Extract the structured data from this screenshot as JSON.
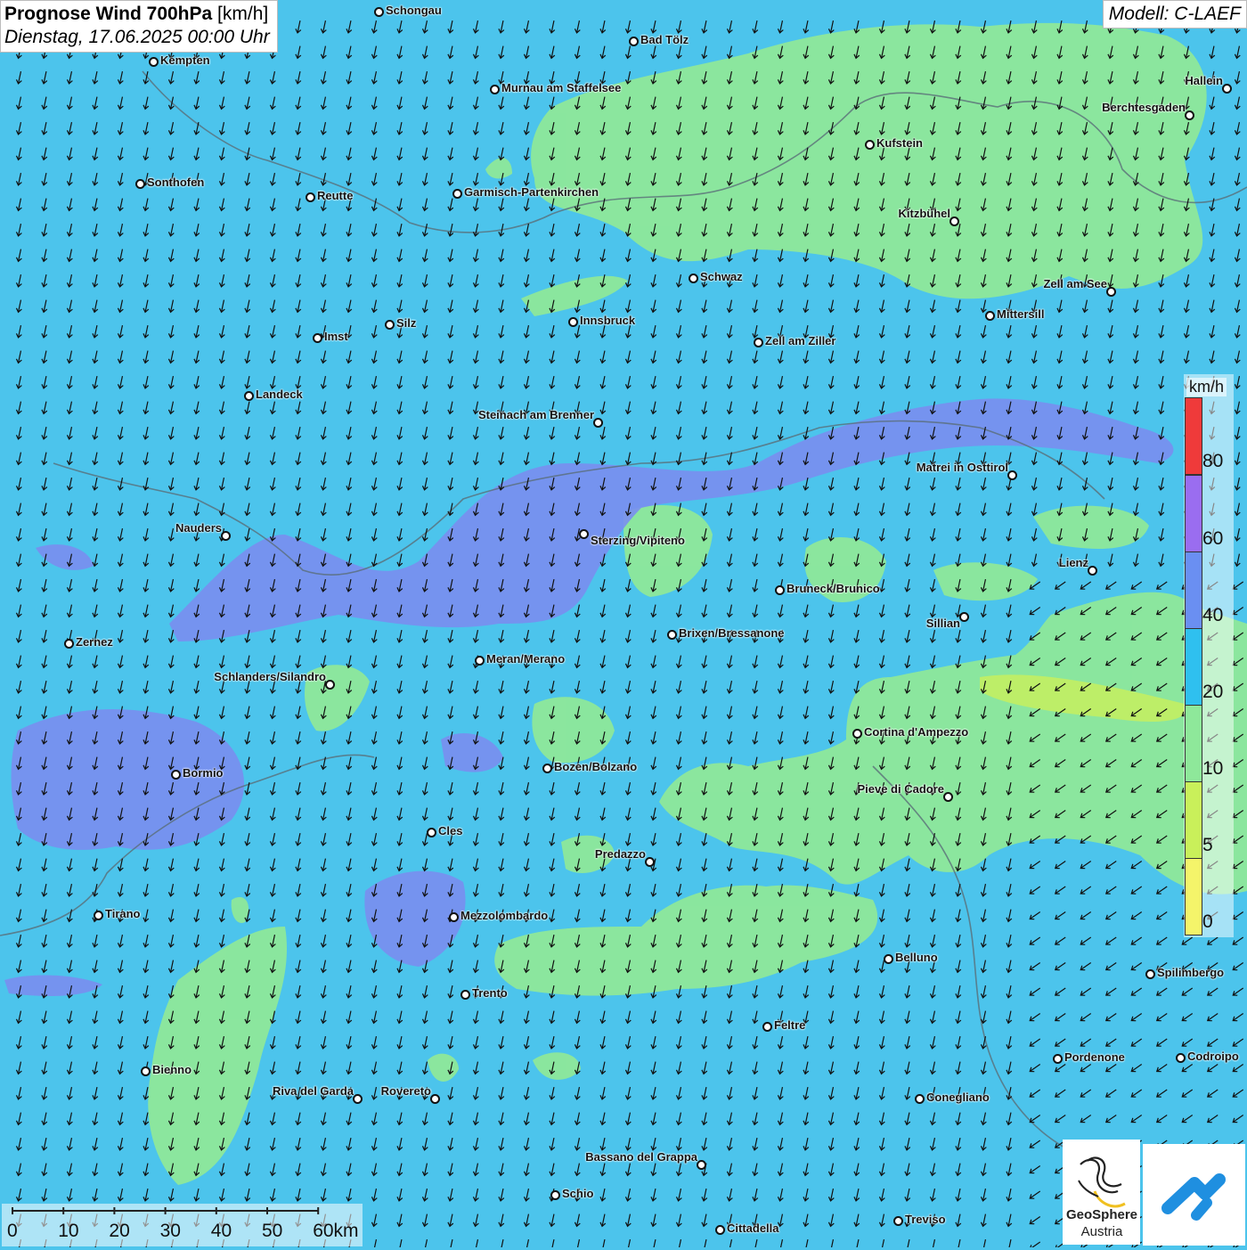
{
  "title": {
    "bold": "Prognose Wind 700hPa",
    "unit": "[km/h]",
    "datetime": "Dienstag, 17.06.2025 00:00 Uhr"
  },
  "model": "Modell: C-LAEF",
  "legend": {
    "unit": "km/h",
    "labels": [
      "80",
      "60",
      "40",
      "20",
      "10",
      "5",
      "0"
    ],
    "colors": [
      "#ef3a3a",
      "#9a6df0",
      "#6a8ff2",
      "#2fc0ef",
      "#8ee89a",
      "#c9f05a",
      "#f4f46a"
    ]
  },
  "scale": {
    "labels": [
      "0",
      "10",
      "20",
      "30",
      "40",
      "50",
      "60km"
    ]
  },
  "logo": {
    "name": "GeoSphere",
    "sub": "Austria"
  },
  "wind_field": {
    "direction": "north-northeasterly",
    "arrow_icon": "wind-arrow-icon"
  },
  "cities": [
    {
      "name": "Schongau"
    },
    {
      "name": "Bad Tölz"
    },
    {
      "name": "Kempten"
    },
    {
      "name": "Murnau am Staffelsee"
    },
    {
      "name": "Hallein"
    },
    {
      "name": "Berchtesgaden"
    },
    {
      "name": "Kufstein"
    },
    {
      "name": "Sonthofen"
    },
    {
      "name": "Reutte"
    },
    {
      "name": "Garmisch-Partenkirchen"
    },
    {
      "name": "Kitzbühel"
    },
    {
      "name": "Schwaz"
    },
    {
      "name": "Zell am See"
    },
    {
      "name": "Innsbruck"
    },
    {
      "name": "Mittersill"
    },
    {
      "name": "Silz"
    },
    {
      "name": "Imst"
    },
    {
      "name": "Zell am Ziller"
    },
    {
      "name": "Landeck"
    },
    {
      "name": "Steinach am Brenner"
    },
    {
      "name": "Matrei in Osttirol"
    },
    {
      "name": "Nauders"
    },
    {
      "name": "Sterzing/Vipiteno"
    },
    {
      "name": "Lienz"
    },
    {
      "name": "Bruneck/Brunico"
    },
    {
      "name": "Sillian"
    },
    {
      "name": "Brixen/Bressanone"
    },
    {
      "name": "Zernez"
    },
    {
      "name": "Meran/Merano"
    },
    {
      "name": "Schlanders/Silandro"
    },
    {
      "name": "Cortina d'Ampezzo"
    },
    {
      "name": "Bozen/Bolzano"
    },
    {
      "name": "Bormio"
    },
    {
      "name": "Pieve di Cadore"
    },
    {
      "name": "Cles"
    },
    {
      "name": "Predazzo"
    },
    {
      "name": "Tirano"
    },
    {
      "name": "Mezzolombardo"
    },
    {
      "name": "Belluno"
    },
    {
      "name": "Spilimbergo"
    },
    {
      "name": "Trento"
    },
    {
      "name": "Feltre"
    },
    {
      "name": "Pordenone"
    },
    {
      "name": "Codroipo"
    },
    {
      "name": "Bienno"
    },
    {
      "name": "Riva del Garda"
    },
    {
      "name": "Rovereto"
    },
    {
      "name": "Conegliano"
    },
    {
      "name": "Bassano del Grappa"
    },
    {
      "name": "Schio"
    },
    {
      "name": "Treviso"
    },
    {
      "name": "Cittadella"
    }
  ]
}
